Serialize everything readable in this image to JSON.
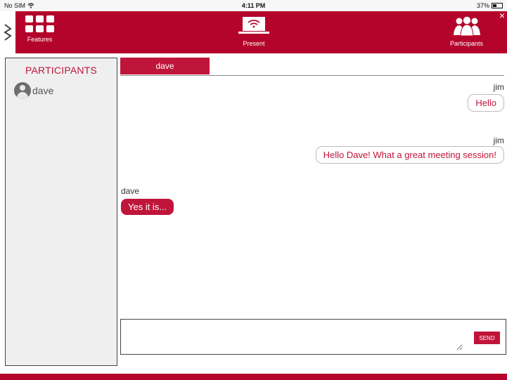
{
  "status_bar": {
    "carrier": "No SIM",
    "time": "4:11 PM",
    "battery": "37%"
  },
  "header": {
    "features_label": "Features",
    "present_label": "Present",
    "participants_label": "Participants",
    "close": "×"
  },
  "participants_panel": {
    "title": "PARTICIPANTS",
    "items": [
      {
        "name": "dave"
      }
    ]
  },
  "chat": {
    "active_tab": "dave",
    "messages": [
      {
        "sender": "jim",
        "text": "Hello",
        "direction": "outgoing"
      },
      {
        "sender": "jim",
        "text": "Hello Dave! What a great meeting session!",
        "direction": "outgoing"
      },
      {
        "sender": "dave",
        "text": "Yes it is...",
        "direction": "incoming"
      }
    ],
    "input_value": "",
    "input_placeholder": "",
    "send_label": "SEND"
  },
  "colors": {
    "brand": "#b5042b",
    "accent": "#c0153a"
  },
  "icons": {
    "wifi": "wifi-icon",
    "features": "grid-icon",
    "present": "present-wifi-laptop-icon",
    "participants": "people-group-icon",
    "avatar": "user-avatar-icon",
    "close": "close-icon"
  }
}
